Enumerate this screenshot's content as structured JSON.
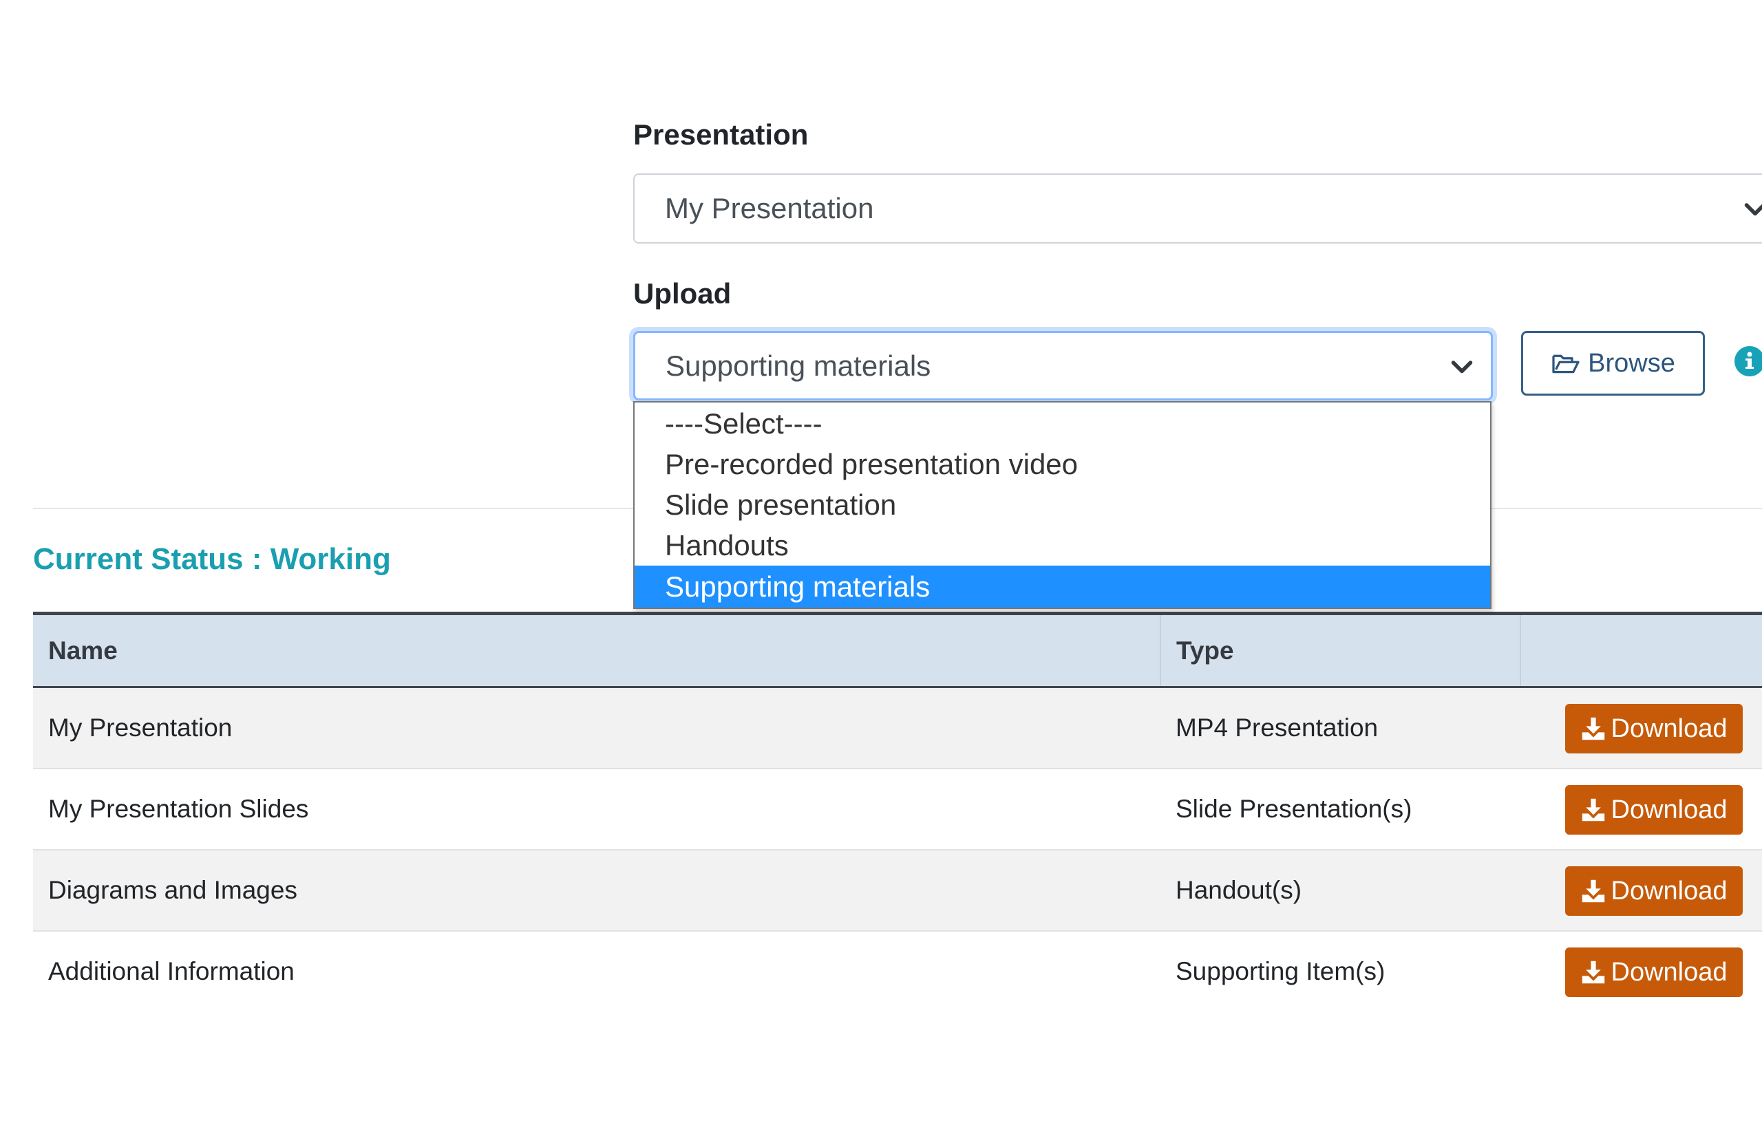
{
  "presentation": {
    "label": "Presentation",
    "selected": "My Presentation"
  },
  "upload": {
    "label": "Upload",
    "selected": "Supporting materials",
    "options": [
      "----Select----",
      "Pre-recorded presentation video",
      "Slide presentation",
      "Handouts",
      "Supporting materials"
    ],
    "highlighted_option": "Supporting materials",
    "browse_label": "Browse",
    "info_icon": "info-circle-icon"
  },
  "status": {
    "text": "Current Status : Working",
    "color": "#1a9fb0"
  },
  "table": {
    "columns": [
      "Name",
      "Type",
      ""
    ],
    "rows": [
      {
        "name": "My Presentation",
        "type": "MP4 Presentation",
        "action": "Download"
      },
      {
        "name": "My Presentation Slides",
        "type": "Slide Presentation(s)",
        "action": "Download"
      },
      {
        "name": "Diagrams and Images",
        "type": "Handout(s)",
        "action": "Download"
      },
      {
        "name": "Additional Information",
        "type": "Supporting Item(s)",
        "action": "Download"
      }
    ]
  },
  "colors": {
    "download_button": "#c65a09",
    "dropdown_highlight": "#1e90ff",
    "table_header_bg": "#d6e1ee",
    "browse_border": "#355f87"
  }
}
